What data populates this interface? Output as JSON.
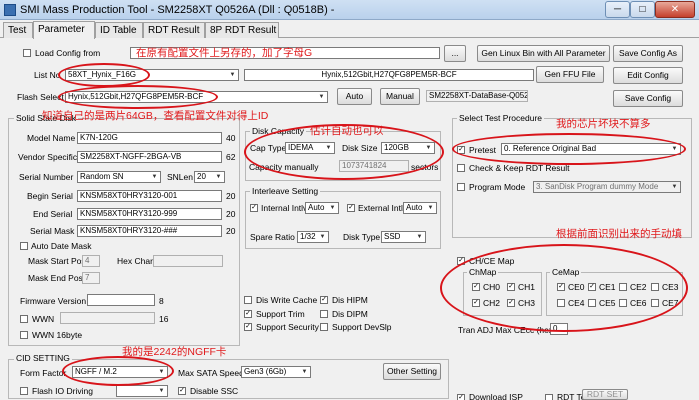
{
  "window": {
    "title": "SMI Mass Production Tool      - SM2258XT    Q0526A     (Dll : Q0518B) -",
    "min": "─",
    "max": "□",
    "close": "✕"
  },
  "tabs": [
    "Test",
    "Parameter",
    "ID Table",
    "RDT Result",
    "8P RDT Result"
  ],
  "top": {
    "load_config_label": "Load Config from",
    "load_config_path": "",
    "browse": "...",
    "gen_linux_bin": "Gen Linux Bin with All Parameter",
    "save_config_as": "Save Config As",
    "list_no_label": "List No",
    "list_no_value": "58XT_Hynix_F16G",
    "list_info": "Hynix,512Gbit,H27QFG8PEM5R-BCF",
    "gen_ffu": "Gen FFU File",
    "edit_config": "Edit Config",
    "flash_select_label": "Flash Select",
    "flash_select_value": "Hynix,512Gbit,H27QFG8PEM5R-BCF",
    "auto": "Auto",
    "manual": "Manual",
    "database": "SM2258XT-DataBase-Q0525",
    "save_config": "Save Config"
  },
  "ssd": {
    "group": "Solid State Disk",
    "model_name_label": "Model Name",
    "model_name": "K7N-120G",
    "model_name_len": "40",
    "vendor_label": "Vendor Specific",
    "vendor": "SM2258XT-NGFF-2BGA-VB",
    "vendor_len": "62",
    "serial_label": "Serial Number",
    "serial_mode": "Random SN",
    "snlen_label": "SNLen",
    "snlen": "20",
    "begin_label": "Begin Serial",
    "begin": "KNSM58XT0HRY3120-001",
    "begin_len": "20",
    "end_label": "End Serial",
    "end": "KNSM58XT0HRY3120-999",
    "end_len": "20",
    "mask_label": "Serial Mask",
    "mask": "KNSM58XT0HRY3120-###",
    "mask_len": "20",
    "auto_date_label": "Auto Date Mask",
    "mask_start_label": "Mask Start Pos",
    "mask_start": "4",
    "hex_char_label": "Hex Char:",
    "mask_end_label": "Mask End Pos",
    "mask_end": "7",
    "fw_version_label": "Firmware Version",
    "fw_version_len": "8",
    "wwn_label": "WWN",
    "wwn_len": "16",
    "wwn16_label": "WWN 16byte"
  },
  "disk": {
    "group": "Disk Capacity",
    "cap_type_label": "Cap Type",
    "cap_type": "IDEMA",
    "disk_size_label": "Disk Size",
    "disk_size": "120GB",
    "manual_label": "Capacity manually",
    "manual_value": "1073741824",
    "sectors": "sectors"
  },
  "interleave": {
    "group": "Interleave Setting",
    "internal_label": "Internal Intlv",
    "internal": "Auto",
    "external_label": "External Intlv",
    "external": "Auto",
    "spare_label": "Spare Ratio",
    "spare": "1/32",
    "disk_type_label": "Disk Type",
    "disk_type": "SSD"
  },
  "features": {
    "dis_write_cache": "Dis Write Cache",
    "dis_hipm": "Dis HIPM",
    "support_trim": "Support Trim",
    "dis_dipm": "Dis DIPM",
    "support_security": "Support Security",
    "support_devslp": "Support DevSlp"
  },
  "cid": {
    "group": "CID SETTING",
    "form_factor_label": "Form Factor",
    "form_factor": "NGFF / M.2",
    "max_sata_label": "Max SATA Speed",
    "max_sata": "Gen3 (6Gb)",
    "other_setting": "Other Setting",
    "flash_io_label": "Flash IO Driving",
    "disable_ssc": "Disable SSC"
  },
  "procedure": {
    "group": "Select Test Procedure",
    "pretest_label": "Pretest",
    "pretest_value": "0. Reference Original Bad",
    "check_keep": "Check & Keep RDT Result",
    "program_mode_label": "Program Mode",
    "program_mode": "3. SanDisk Program dummy Mode"
  },
  "chce": {
    "label": "CH/CE Map",
    "chmap": "ChMap",
    "cemap": "CeMap",
    "ch": [
      "CH0",
      "CH1",
      "CH2",
      "CH3"
    ],
    "ce": [
      "CE0",
      "CE1",
      "CE2",
      "CE3",
      "CE4",
      "CE5",
      "CE6",
      "CE7"
    ],
    "tran_adj_label": "Tran ADJ Max CEcc (hex)",
    "tran_adj": "0"
  },
  "bottom": {
    "download_isp": "Download ISP",
    "rdt_test": "RDT Test",
    "rdt_set": "RDT SET"
  },
  "annotations": {
    "a1": "在原有配置文件上另存的，加了字母G",
    "a2": "知道自己的是两片64GB，查看配置文件对得上ID",
    "a3": "估计自动也可以",
    "a4": "我的芯片坏块不算多",
    "a5": "根据前面识别出来的手动填",
    "a6": "我的是2242的NGFF卡"
  },
  "colors": {
    "annotation": "#e0191b",
    "titlebar": "#c4d8ef"
  }
}
